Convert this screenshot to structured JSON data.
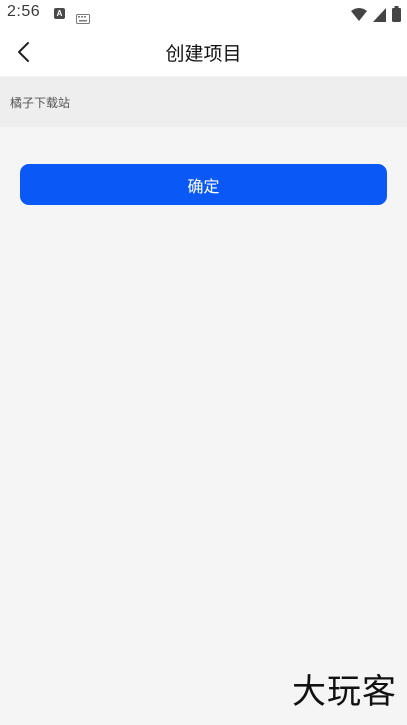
{
  "status_bar": {
    "time": "2:56",
    "notification_letter": "A"
  },
  "header": {
    "title": "创建项目"
  },
  "form": {
    "project_name_value": "橘子下载站",
    "project_name_placeholder": ""
  },
  "actions": {
    "confirm_label": "确定"
  },
  "watermark": {
    "text": "大玩客"
  },
  "colors": {
    "accent": "#0a59f7",
    "background": "#f5f5f5",
    "input_bg": "#eeeeee"
  }
}
